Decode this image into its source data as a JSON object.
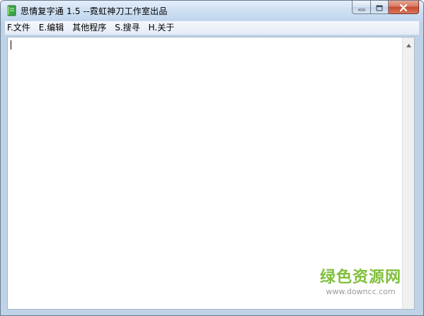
{
  "window": {
    "title": "思情复字通 1.5 --霓虹神刀工作室出品",
    "icon": "notebook-app-icon"
  },
  "caption_buttons": {
    "minimize_icon": "minimize-icon",
    "maximize_icon": "maximize-icon",
    "close_icon": "close-icon"
  },
  "menu": {
    "items": [
      {
        "label": "F.文件"
      },
      {
        "label": "E.编辑"
      },
      {
        "label": "其他程序"
      },
      {
        "label": "S.搜寻"
      },
      {
        "label": "H.关于"
      }
    ]
  },
  "editor": {
    "content": ""
  },
  "watermark": {
    "title": "绿色资源网",
    "url": "www.downcc.com"
  },
  "colors": {
    "accent_green": "#7fbf3a",
    "close_red": "#c74a2f",
    "frame_blue": "#bfd3e8"
  }
}
